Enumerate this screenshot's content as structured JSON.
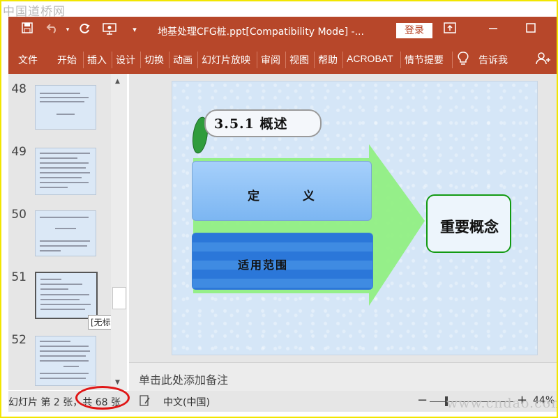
{
  "watermarks": {
    "top": "中国道桥网",
    "bottom": "www.cndao.com"
  },
  "titlebar": {
    "doc_title": "地基处理CFG桩.ppt[Compatibility Mode]  -...",
    "login_label": "登录"
  },
  "ribbon": {
    "tabs": [
      "文件",
      "开始",
      "插入",
      "设计",
      "切换",
      "动画",
      "幻灯片放映",
      "审阅",
      "视图",
      "帮助",
      "ACROBAT",
      "情节提要",
      "告诉我"
    ]
  },
  "thumbnails": [
    {
      "number": "48",
      "selected": false
    },
    {
      "number": "49",
      "selected": false
    },
    {
      "number": "50",
      "selected": false
    },
    {
      "number": "51",
      "selected": true
    },
    {
      "number": "52",
      "selected": false
    }
  ],
  "tooltip": "[无标题]",
  "slide": {
    "heading": "3.5.1 概述",
    "definition": "定 义",
    "scope": "适用范围",
    "concept": "重要概念"
  },
  "notes_placeholder": "单击此处添加备注",
  "status": {
    "slide_counter": "幻灯片 第 2 张，共 68 张",
    "language": "中文(中国)",
    "zoom_level": "44%",
    "zoom_minus": "−",
    "zoom_plus": "+"
  },
  "colors": {
    "accent": "#b7472a",
    "circle": "#e01616",
    "concept_border": "#129a12"
  },
  "icons": [
    "save-icon",
    "undo-icon",
    "redo-icon",
    "present-icon",
    "customize-icon",
    "ribbon-display-icon",
    "minimize-icon",
    "maximize-icon",
    "lightbulb-icon",
    "share-icon",
    "notes-icon"
  ]
}
